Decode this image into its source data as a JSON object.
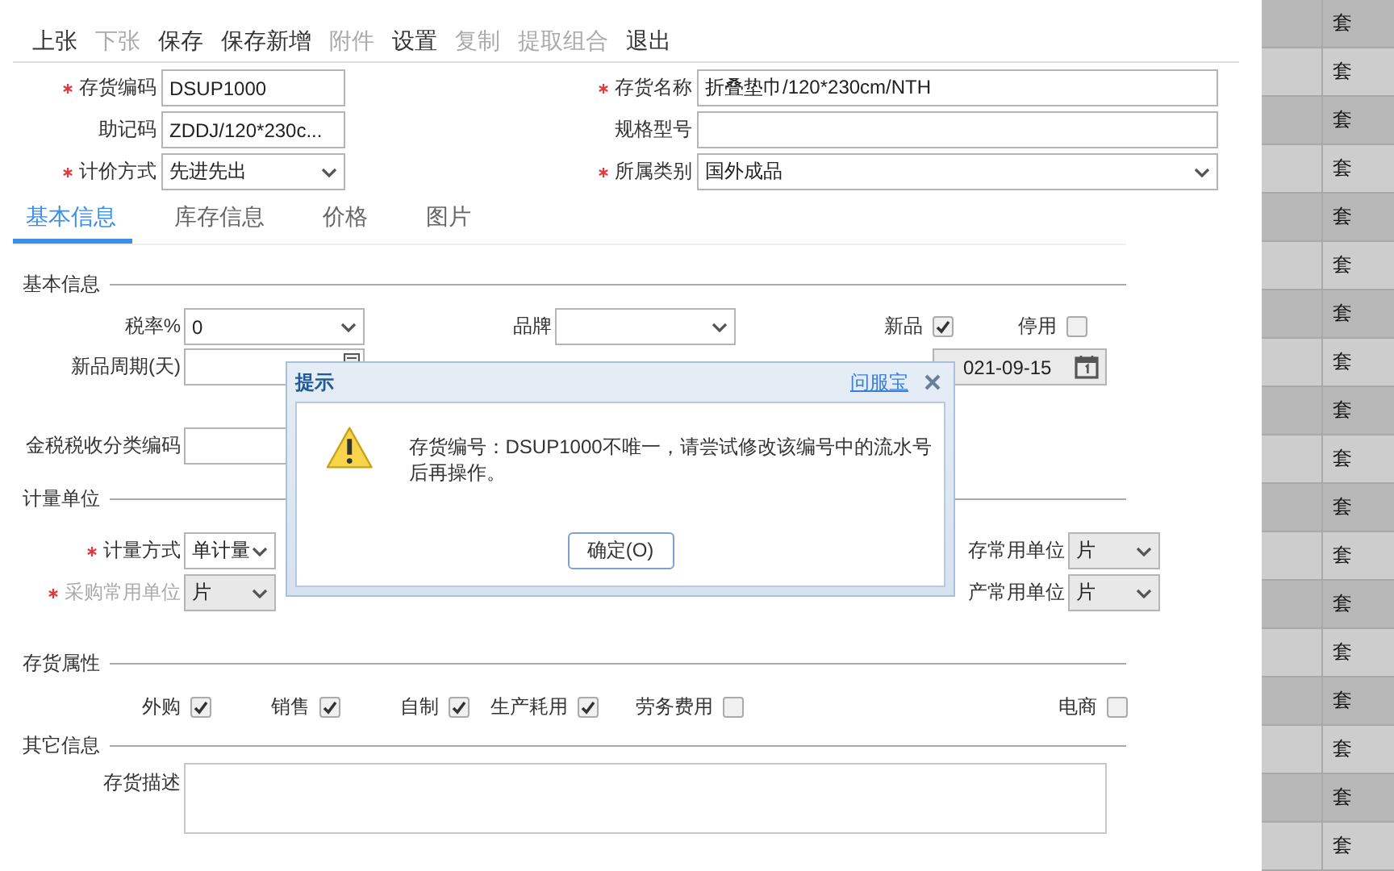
{
  "toolbar": [
    {
      "label": "上张",
      "disabled": false
    },
    {
      "label": "下张",
      "disabled": true
    },
    {
      "label": "保存",
      "disabled": false
    },
    {
      "label": "保存新增",
      "disabled": false
    },
    {
      "label": "附件",
      "disabled": true
    },
    {
      "label": "设置",
      "disabled": false
    },
    {
      "label": "复制",
      "disabled": true
    },
    {
      "label": "提取组合",
      "disabled": true
    },
    {
      "label": "退出",
      "disabled": false
    }
  ],
  "header_rows": [
    [
      {
        "label": "存货编码",
        "required": true,
        "kind": "text",
        "value": "DSUP1000"
      },
      {
        "label": "存货名称",
        "required": true,
        "kind": "text",
        "value": "折叠垫巾/120*230cm/NTH"
      }
    ],
    [
      {
        "label": "助记码",
        "required": false,
        "kind": "text",
        "value": "ZDDJ/120*230c..."
      },
      {
        "label": "规格型号",
        "required": false,
        "kind": "text"
      }
    ],
    [
      {
        "label": "计价方式",
        "required": true,
        "kind": "select",
        "value": "先进先出"
      },
      {
        "label": "所属类别",
        "required": true,
        "kind": "select",
        "value": "国外成品"
      }
    ]
  ],
  "tabs": [
    {
      "label": "基本信息",
      "selected": true
    },
    {
      "label": "库存信息",
      "selected": false
    },
    {
      "label": "价格",
      "selected": false
    },
    {
      "label": "图片",
      "selected": false
    }
  ],
  "basic_info": {
    "title": "基本信息",
    "tax_rate": {
      "label": "税率%",
      "value": "0"
    },
    "brand": {
      "label": "品牌"
    },
    "new_product": {
      "label": "新品",
      "checked": true
    },
    "disabled_flag": {
      "label": "停用",
      "checked": false
    },
    "new_period": {
      "label": "新品周期(天)"
    },
    "date": {
      "value": "021-09-15"
    },
    "tax_code": {
      "label": "金税税收分类编码"
    }
  },
  "units": {
    "title": "计量单位",
    "method": {
      "label": "计量方式",
      "required": true,
      "value": "单计量",
      "disabled": false
    },
    "purchase": {
      "label": "采购常用单位",
      "required": true,
      "value": "片",
      "disabled": true
    },
    "stock": {
      "label": "存常用单位",
      "value": "片"
    },
    "production": {
      "label": "产常用单位",
      "value": "片"
    }
  },
  "attributes": {
    "title": "存货属性",
    "items": [
      {
        "label": "外购",
        "checked": true
      },
      {
        "label": "销售",
        "checked": true
      },
      {
        "label": "自制",
        "checked": true
      },
      {
        "label": "生产耗用",
        "checked": true
      },
      {
        "label": "劳务费用",
        "checked": false
      },
      {
        "label": "电商",
        "checked": false
      }
    ]
  },
  "other": {
    "title": "其它信息",
    "description": {
      "label": "存货描述"
    }
  },
  "dialog": {
    "title": "提示",
    "link": "问服宝",
    "message": "存货编号：DSUP1000不唯一，请尝试修改该编号中的流水号后再操作。",
    "button": "确定(O)"
  },
  "side_rows": [
    "套",
    "套",
    "套",
    "套",
    "套",
    "套",
    "套",
    "套",
    "套",
    "套",
    "套",
    "套",
    "套",
    "套",
    "套",
    "套",
    "套",
    "套"
  ]
}
